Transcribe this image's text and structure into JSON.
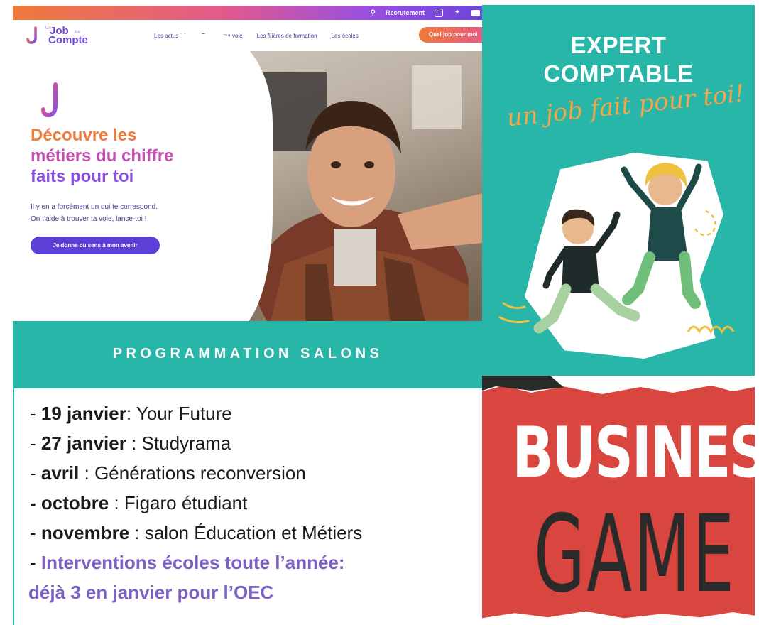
{
  "website": {
    "topbar": {
      "search_icon": "search-icon",
      "recruit_link": "Recrutement",
      "social_icons": [
        "instagram-icon",
        "twitter-icon",
        "youtube-icon"
      ]
    },
    "logo": {
      "small_un": "Un",
      "job": "Job",
      "small_au": "au",
      "compte": "Compte"
    },
    "nav": {
      "items": [
        {
          "label": "Les actus job"
        },
        {
          "label": "Trouver ma voie"
        },
        {
          "label": "Les filières de formation"
        },
        {
          "label": "Les écoles"
        }
      ],
      "cta": "Quel job pour moi"
    },
    "hero": {
      "title_line1": "Découvre les",
      "title_line2": "métiers du chiffre",
      "title_line3": "faits pour toi",
      "subtitle_line1": "Il y en a forcément un qui te correspond.",
      "subtitle_line2": "On t’aide à trouver ta voie, lance-toi !",
      "button": "Je donne du sens à mon avenir",
      "scroll_arrow": "↓"
    }
  },
  "expert_panel": {
    "line1": "EXPERT",
    "line2": "COMPTABLE",
    "tagline": "un job fait pour toi!"
  },
  "salons": {
    "title": "PROGRAMMATION SALONS",
    "items": [
      {
        "prefix": "- ",
        "date": "19 janvier",
        "sep": ":  ",
        "event": "Your Future"
      },
      {
        "prefix": "- ",
        "date": "27 janvier",
        "sep": " : ",
        "event": "Studyrama"
      },
      {
        "prefix": "- ",
        "date": "avril",
        "sep": " : ",
        "event": "Générations reconversion"
      },
      {
        "prefix": "- ",
        "date": "octobre",
        "sep": " : ",
        "event": "Figaro étudiant"
      },
      {
        "prefix": "- ",
        "date": "novembre",
        "sep": " : ",
        "event": "salon Éducation et Métiers"
      }
    ],
    "highlight_prefix": "- ",
    "highlight_line1": "Interventions écoles toute l’année:",
    "highlight_line2": "déjà 3 en janvier pour l’OEC"
  },
  "business_game": {
    "word1": "BUSINESS",
    "word2": "GAME"
  },
  "colors": {
    "teal": "#27b6a7",
    "purple": "#7b61c4",
    "orange": "#f07a3a",
    "red": "#d9453f"
  }
}
